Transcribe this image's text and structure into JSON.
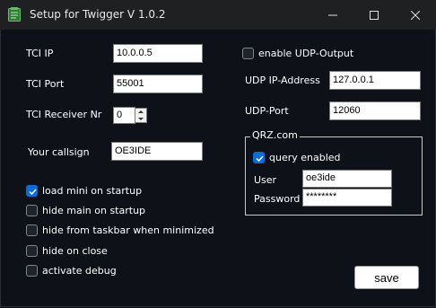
{
  "window": {
    "title": "Setup for Twigger V 1.0.2",
    "icon": "twigger-app-icon",
    "controls": [
      "minimize-icon",
      "maximize-icon",
      "close-icon"
    ]
  },
  "left": {
    "tci_ip": {
      "label": "TCI IP",
      "value": "10.0.0.5"
    },
    "tci_port": {
      "label": "TCI Port",
      "value": "55001"
    },
    "tci_receiver": {
      "label": "TCI Receiver Nr",
      "value": "0"
    },
    "callsign": {
      "label": "Your callsign",
      "value": "OE3IDE"
    },
    "options": [
      {
        "label": "load mini on startup",
        "checked": true
      },
      {
        "label": "hide main on startup",
        "checked": false
      },
      {
        "label": "hide from taskbar when minimized",
        "checked": false
      },
      {
        "label": "hide on close",
        "checked": false
      },
      {
        "label": "activate debug",
        "checked": false
      }
    ]
  },
  "right": {
    "udp_enable": {
      "label": "enable UDP-Output",
      "checked": false
    },
    "udp_ip": {
      "label": "UDP IP-Address",
      "value": "127.0.0.1"
    },
    "udp_port": {
      "label": "UDP-Port",
      "value": "12060"
    },
    "qrz": {
      "title": "QRZ.com",
      "query": {
        "label": "query enabled",
        "checked": true
      },
      "user": {
        "label": "User",
        "value": "oe3ide"
      },
      "password": {
        "label": "Password",
        "value": "********"
      }
    }
  },
  "save_label": "save",
  "colors": {
    "accent": "#0a6cd6",
    "background": "#0e1218",
    "titlebar": "#1f2021"
  }
}
